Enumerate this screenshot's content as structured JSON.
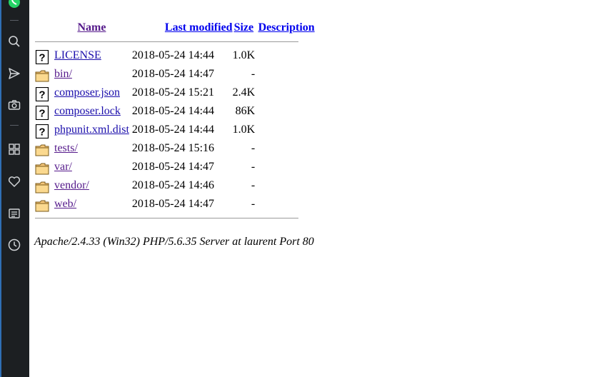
{
  "sidebar": {
    "icons": [
      "whatsapp-icon",
      "search-icon",
      "send-icon",
      "camera-icon",
      "grid-icon",
      "heart-icon",
      "news-icon",
      "history-icon"
    ]
  },
  "listing": {
    "headers": {
      "name": "Name",
      "last_modified": "Last modified",
      "size": "Size",
      "description": "Description"
    },
    "rows": [
      {
        "name": "LICENSE",
        "date": "2018-05-24 14:44",
        "size": "1.0K",
        "type": "file"
      },
      {
        "name": "bin/",
        "date": "2018-05-24 14:47",
        "size": "-",
        "type": "folder"
      },
      {
        "name": "composer.json",
        "date": "2018-05-24 15:21",
        "size": "2.4K",
        "type": "file"
      },
      {
        "name": "composer.lock",
        "date": "2018-05-24 14:44",
        "size": "86K",
        "type": "file"
      },
      {
        "name": "phpunit.xml.dist",
        "date": "2018-05-24 14:44",
        "size": "1.0K",
        "type": "file"
      },
      {
        "name": "tests/",
        "date": "2018-05-24 15:16",
        "size": "-",
        "type": "folder"
      },
      {
        "name": "var/",
        "date": "2018-05-24 14:47",
        "size": "-",
        "type": "folder"
      },
      {
        "name": "vendor/",
        "date": "2018-05-24 14:46",
        "size": "-",
        "type": "folder"
      },
      {
        "name": "web/",
        "date": "2018-05-24 14:47",
        "size": "-",
        "type": "folder"
      }
    ]
  },
  "footer": {
    "server_signature": "Apache/2.4.33 (Win32) PHP/5.6.35 Server at laurent Port 80"
  }
}
